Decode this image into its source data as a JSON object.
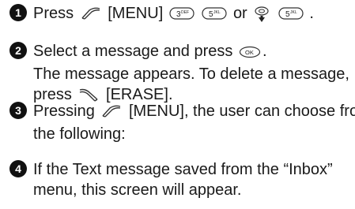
{
  "steps": [
    {
      "number": "1",
      "press": "Press",
      "menu": "[MENU]",
      "key3_main": "3",
      "key3_sub": "DEF",
      "key5_main": "5",
      "key5_sub": "JKL",
      "or": "or",
      "key5b_main": "5",
      "key5b_sub": "JKL",
      "end": "."
    },
    {
      "number": "2",
      "line1_pre": "Select a message and press",
      "ok_label": "OK",
      "line1_post": ".",
      "line2": "The message appears. To delete a message,",
      "line3_pre": "press",
      "line3_post": "[ERASE]."
    },
    {
      "number": "3",
      "line1_pre": "Pressing",
      "line1_post": "[MENU], the user can choose from",
      "line2": "the following:"
    },
    {
      "number": "4",
      "line1": "If the Text message saved from the “Inbox”",
      "line2": "menu, this screen will appear."
    }
  ]
}
